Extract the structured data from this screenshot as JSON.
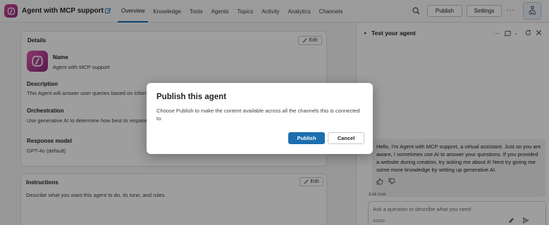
{
  "header": {
    "title": "Agent with MCP support",
    "tabs": [
      "Overview",
      "Knowledge",
      "Tools",
      "Agents",
      "Topics",
      "Activity",
      "Analytics",
      "Channels"
    ],
    "active_tab": "Overview",
    "publish_label": "Publish",
    "settings_label": "Settings",
    "more_label": "···",
    "test_label": "Test"
  },
  "details": {
    "title": "Details",
    "edit_label": "Edit",
    "name_label": "Name",
    "name_value": "Agent with MCP support",
    "description_label": "Description",
    "description_value": "This Agent will answer user queries based on inform",
    "orchestration_label": "Orchestration",
    "orchestration_value": "Use generative AI to determine how best to respond",
    "model_label": "Response model",
    "model_value": "GPT-4o (default)"
  },
  "instructions": {
    "title": "Instructions",
    "edit_label": "Edit",
    "placeholder_text": "Describe what you want this agent to do, its tone, and rules."
  },
  "test_panel": {
    "title": "Test your agent",
    "message": "Hello, I'm Agent with MCP support, a virtual assistant. Just so you are aware, I sometimes use AI to answer your questions. If you provided a website during creation, try asking me about it! Next try giving me some more knowledge by setting up generative AI.",
    "timestamp": "Just now",
    "input_placeholder": "Ask a question or describe what you need",
    "char_counter": "0/2000"
  },
  "dialog": {
    "title": "Publish this agent",
    "body": "Choose Publish to make the content available across all the channels this is connected to.",
    "primary_label": "Publish",
    "cancel_label": "Cancel"
  },
  "colors": {
    "accent": "#0f6cbd",
    "primary_button": "#1b6fae",
    "logo_gradient_start": "#d44a9e",
    "logo_gradient_end": "#8a2a7a"
  }
}
